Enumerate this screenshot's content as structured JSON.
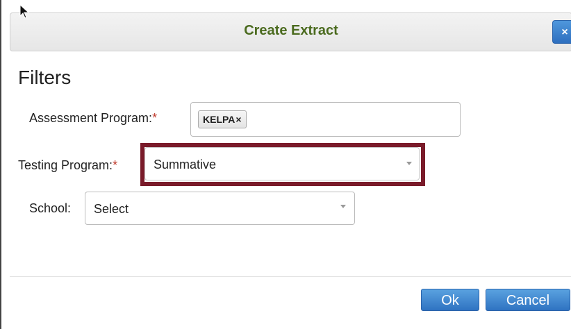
{
  "dialog": {
    "title": "Create Extract",
    "close_label": "×"
  },
  "filters": {
    "heading": "Filters",
    "assessment_program": {
      "label": "Assessment Program:",
      "required_mark": "*",
      "selected_tag": "KELPA",
      "tag_remove": "×"
    },
    "testing_program": {
      "label": "Testing Program:",
      "required_mark": "*",
      "value": "Summative",
      "highlighted": true
    },
    "school": {
      "label": "School:",
      "value": "Select"
    }
  },
  "buttons": {
    "ok_label": "Ok",
    "cancel_label": "Cancel"
  },
  "colors": {
    "title": "#4b6b1f",
    "highlight_border": "#7a1b2a",
    "button_blue": "#2f73c2",
    "required": "#c0392b"
  },
  "icons": [
    "mouse-pointer-icon",
    "close-icon",
    "chevron-down-icon"
  ]
}
